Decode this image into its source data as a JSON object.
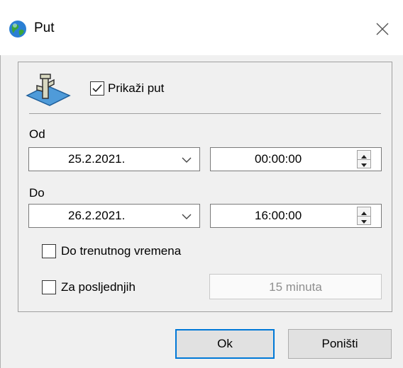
{
  "window": {
    "title": "Put",
    "icon": "globe-icon",
    "close_icon": "close-icon"
  },
  "show_route": {
    "label": "Prikaži put",
    "checked": true,
    "icon": "route-pin-icon"
  },
  "from": {
    "label": "Od",
    "date": "25.2.2021.",
    "time": "00:00:00"
  },
  "to": {
    "label": "Do",
    "date": "26.2.2021.",
    "time": "16:00:00"
  },
  "until_now": {
    "label": "Do trenutnog vremena",
    "checked": false
  },
  "last": {
    "label": "Za posljednjih",
    "checked": false,
    "duration": "15 minuta"
  },
  "buttons": {
    "ok": "Ok",
    "cancel": "Poništi"
  }
}
